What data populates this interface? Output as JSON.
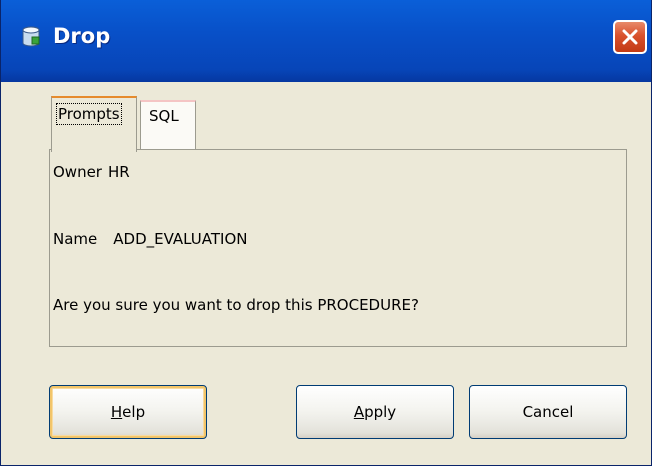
{
  "window": {
    "title": "Drop",
    "icon": "database-cylinder-icon",
    "close_icon": "close-x-icon"
  },
  "tabs": [
    {
      "label": "Prompts",
      "selected": true
    },
    {
      "label": "SQL",
      "selected": false
    }
  ],
  "prompts": {
    "owner_label": "Owner",
    "owner_value": "HR",
    "name_label": "Name",
    "name_value": "ADD_EVALUATION",
    "message": "Are you sure you want to drop this PROCEDURE?"
  },
  "buttons": {
    "help": {
      "label_mnemonic": "H",
      "label_rest": "elp"
    },
    "apply": {
      "label_mnemonic": "A",
      "label_rest": "pply"
    },
    "cancel": {
      "label": "Cancel"
    }
  },
  "colors": {
    "titlebar": "#0850c8",
    "close_button": "#d9512d",
    "dialog_face": "#ece9d8",
    "button_border": "#003c74",
    "focus_highlight": "#f2c56a",
    "active_tab_accent": "#e68b2c"
  }
}
